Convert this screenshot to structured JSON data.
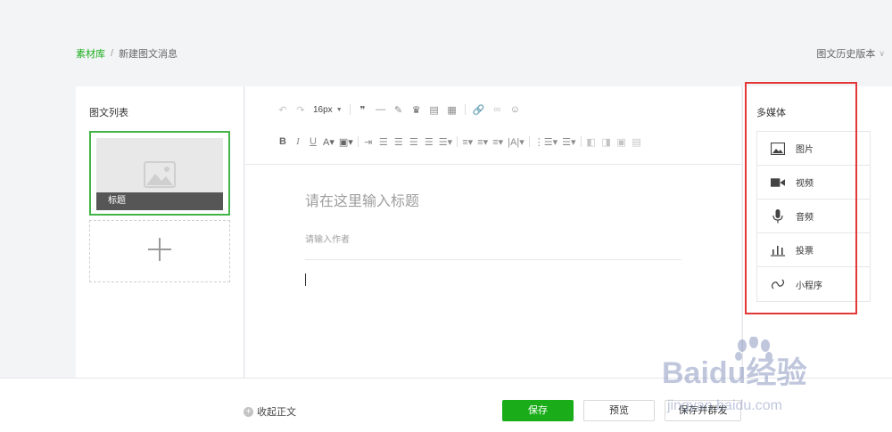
{
  "breadcrumb": {
    "root": "素材库",
    "separator": "/",
    "current": "新建图文消息"
  },
  "history_link": "图文历史版本",
  "article_list": {
    "title": "图文列表",
    "items": [
      {
        "caption": "标题"
      }
    ]
  },
  "toolbar": {
    "font_size": "16px"
  },
  "editor": {
    "title_placeholder": "请在这里输入标题",
    "author_placeholder": "请输入作者"
  },
  "media_panel": {
    "title": "多媒体",
    "items": [
      {
        "label": "图片",
        "icon": "image-icon"
      },
      {
        "label": "视频",
        "icon": "video-icon"
      },
      {
        "label": "音频",
        "icon": "microphone-icon"
      },
      {
        "label": "投票",
        "icon": "bar-chart-icon"
      },
      {
        "label": "小程序",
        "icon": "mini-program-icon"
      }
    ]
  },
  "footer": {
    "collapse_label": "收起正文",
    "save_label": "保存",
    "preview_label": "预览",
    "publish_label": "保存并群发"
  },
  "watermark": {
    "text": "Baidu经验",
    "subtext": "jingyan.baidu.com"
  },
  "colors": {
    "accent": "#1aad19",
    "highlight": "#e33737"
  }
}
